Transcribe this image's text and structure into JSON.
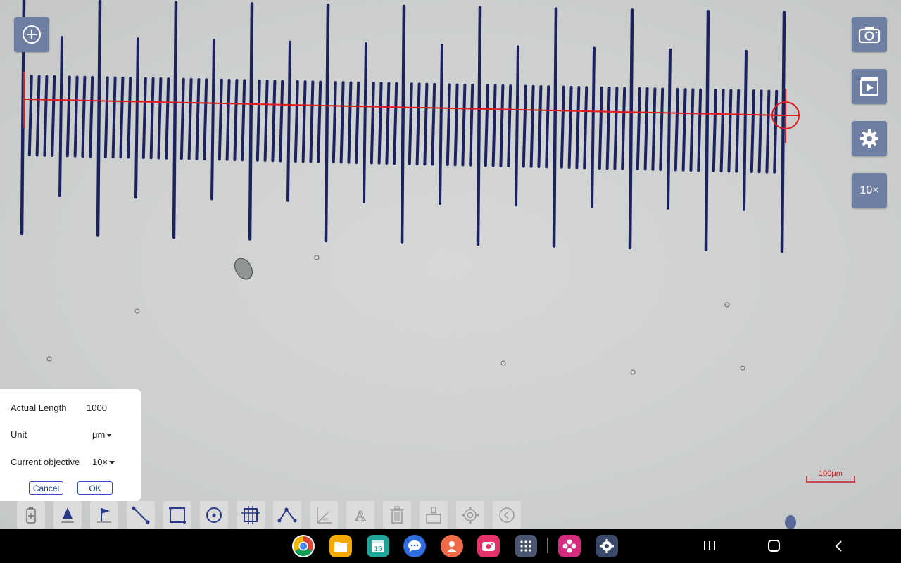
{
  "side_buttons": {
    "zoom_label": "10×"
  },
  "calibration": {
    "actual_length_label": "Actual Length",
    "actual_length_value": "1000",
    "unit_label": "Unit",
    "unit_value": "μm",
    "objective_label": "Current objective",
    "objective_value": "10×",
    "cancel_label": "Cancel",
    "ok_label": "OK"
  },
  "scale_bar": {
    "label": "100μm"
  },
  "toolbar": {
    "tools": [
      "battery-add-icon",
      "pen-tool-icon",
      "flag-icon",
      "line-icon",
      "rectangle-icon",
      "circle-icon",
      "grid-frame-icon",
      "polyline-icon",
      "angle-45-icon",
      "text-icon",
      "trash-icon",
      "broom-icon",
      "settings-icon",
      "back-icon"
    ],
    "angle_label": "45°",
    "text_label": "A"
  },
  "taskbar": {
    "apps": [
      "chrome-icon",
      "folder-icon",
      "calendar-icon",
      "messages-icon",
      "contacts-icon",
      "camera-app-icon",
      "app-drawer-icon",
      "flower-app-icon",
      "settings-app-icon"
    ],
    "calendar_day": "19"
  },
  "colors": {
    "accent_button": "#6f7fa3",
    "measure_line": "#e01b1b",
    "scale_tick": "#1a2260"
  }
}
